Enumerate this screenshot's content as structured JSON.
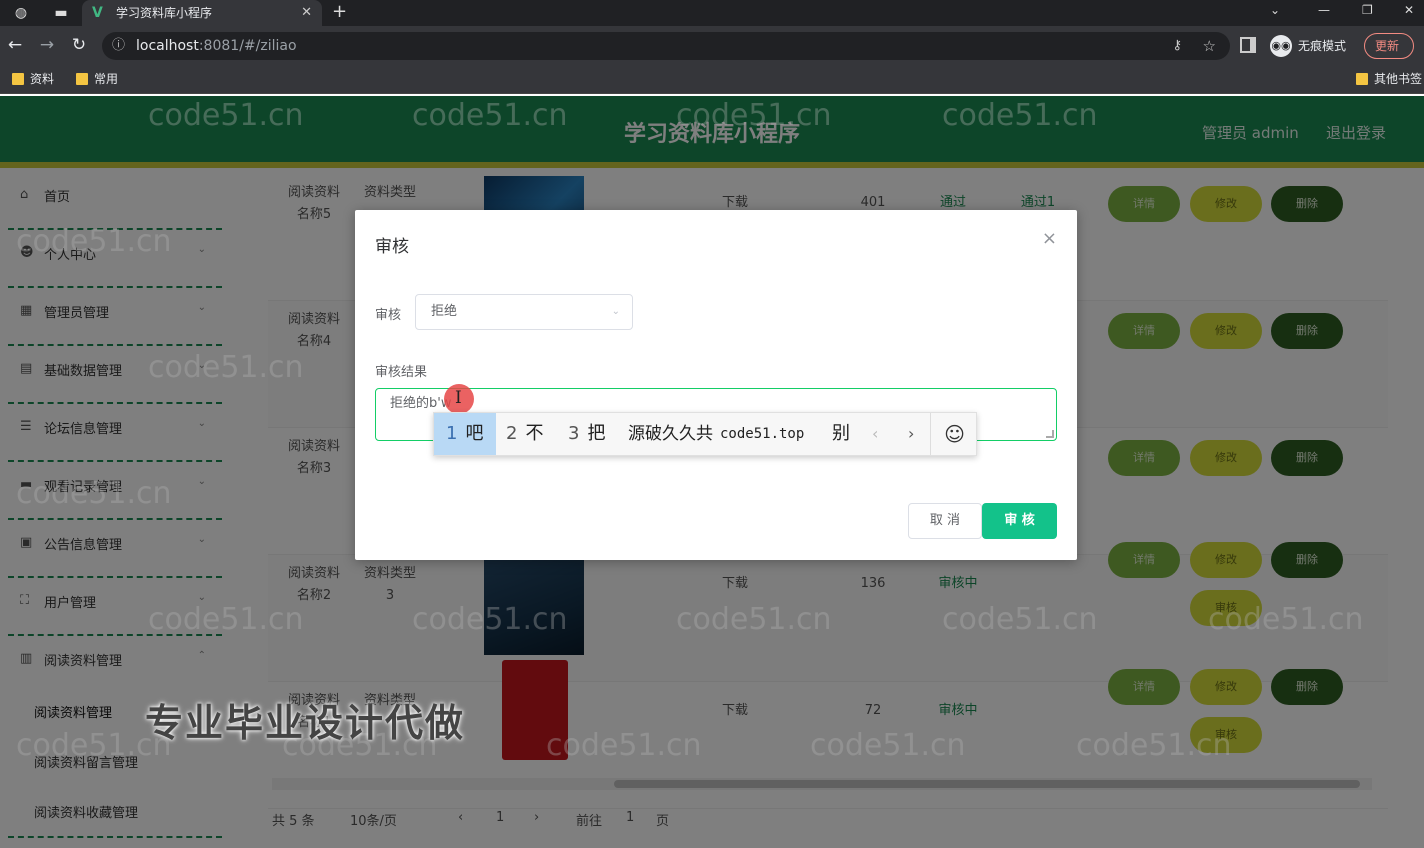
{
  "browser": {
    "tab_title": "学习资料库小程序",
    "tab_close": "✕",
    "new_tab": "+",
    "url_host": "localhost",
    "url_rest": ":8081/#/ziliao",
    "incognito_label": "无痕模式",
    "update_label": "更新",
    "bookmarks": [
      "资料",
      "常用"
    ],
    "other_bookmarks": "其他书签"
  },
  "header": {
    "title": "学习资料库小程序",
    "admin_label": "管理员 admin",
    "logout_label": "退出登录"
  },
  "sidebar": {
    "items": [
      {
        "label": "首页",
        "icon": "home-icon"
      },
      {
        "label": "个人中心",
        "icon": "user-icon"
      },
      {
        "label": "管理员管理",
        "icon": "admin-icon"
      },
      {
        "label": "基础数据管理",
        "icon": "data-icon"
      },
      {
        "label": "论坛信息管理",
        "icon": "forum-icon"
      },
      {
        "label": "观看记录管理",
        "icon": "record-icon"
      },
      {
        "label": "公告信息管理",
        "icon": "notice-icon"
      },
      {
        "label": "用户管理",
        "icon": "users-icon"
      },
      {
        "label": "阅读资料管理",
        "icon": "book-icon"
      }
    ],
    "sub_items": [
      "阅读资料管理",
      "阅读资料留言管理",
      "阅读资料收藏管理"
    ]
  },
  "table": {
    "rows": [
      {
        "name": "阅读资料名称5",
        "type": "资料类型",
        "download": "下载",
        "count": "401",
        "status1": "通过",
        "status2": "通过1"
      },
      {
        "name": "阅读资料名称4",
        "type": "",
        "download": "",
        "count": "",
        "status1": "",
        "status2": ""
      },
      {
        "name": "阅读资料名称3",
        "type": "",
        "download": "",
        "count": "",
        "status1": "",
        "status2": ""
      },
      {
        "name": "阅读资料名称2",
        "type": "资料类型3",
        "download": "下载",
        "count": "136",
        "status1": "审核中",
        "status2": ""
      },
      {
        "name": "阅读资料名称1",
        "type": "资料类型",
        "download": "下载",
        "count": "72",
        "status1": "审核中",
        "status2": ""
      }
    ],
    "buttons": {
      "detail": "详情",
      "edit": "修改",
      "delete": "删除",
      "audit": "审核"
    }
  },
  "pager": {
    "total": "共 5 条",
    "page_size": "10条/页",
    "prev": "‹",
    "current": "1",
    "next": "›",
    "goto": "前往",
    "goto_value": "1",
    "page_unit": "页"
  },
  "dialog": {
    "title": "审核",
    "close": "×",
    "audit_label": "审核",
    "audit_value": "拒绝",
    "result_label": "审核结果",
    "result_value": "拒绝的b'w",
    "cancel_label": "取 消",
    "confirm_label": "审 核"
  },
  "ime": {
    "candidates": [
      {
        "num": "1",
        "text": "吧"
      },
      {
        "num": "2",
        "text": "不"
      },
      {
        "num": "3",
        "text": "把"
      },
      {
        "num": "",
        "text": "源破久久共"
      },
      {
        "num": "",
        "text": "code51.top"
      },
      {
        "num": "",
        "text": "别"
      }
    ],
    "prev": "‹",
    "next": "›",
    "emoji": "☺"
  },
  "overlay_text": {
    "watermark": "code51.cn",
    "promo": "专业毕业设计代做"
  }
}
